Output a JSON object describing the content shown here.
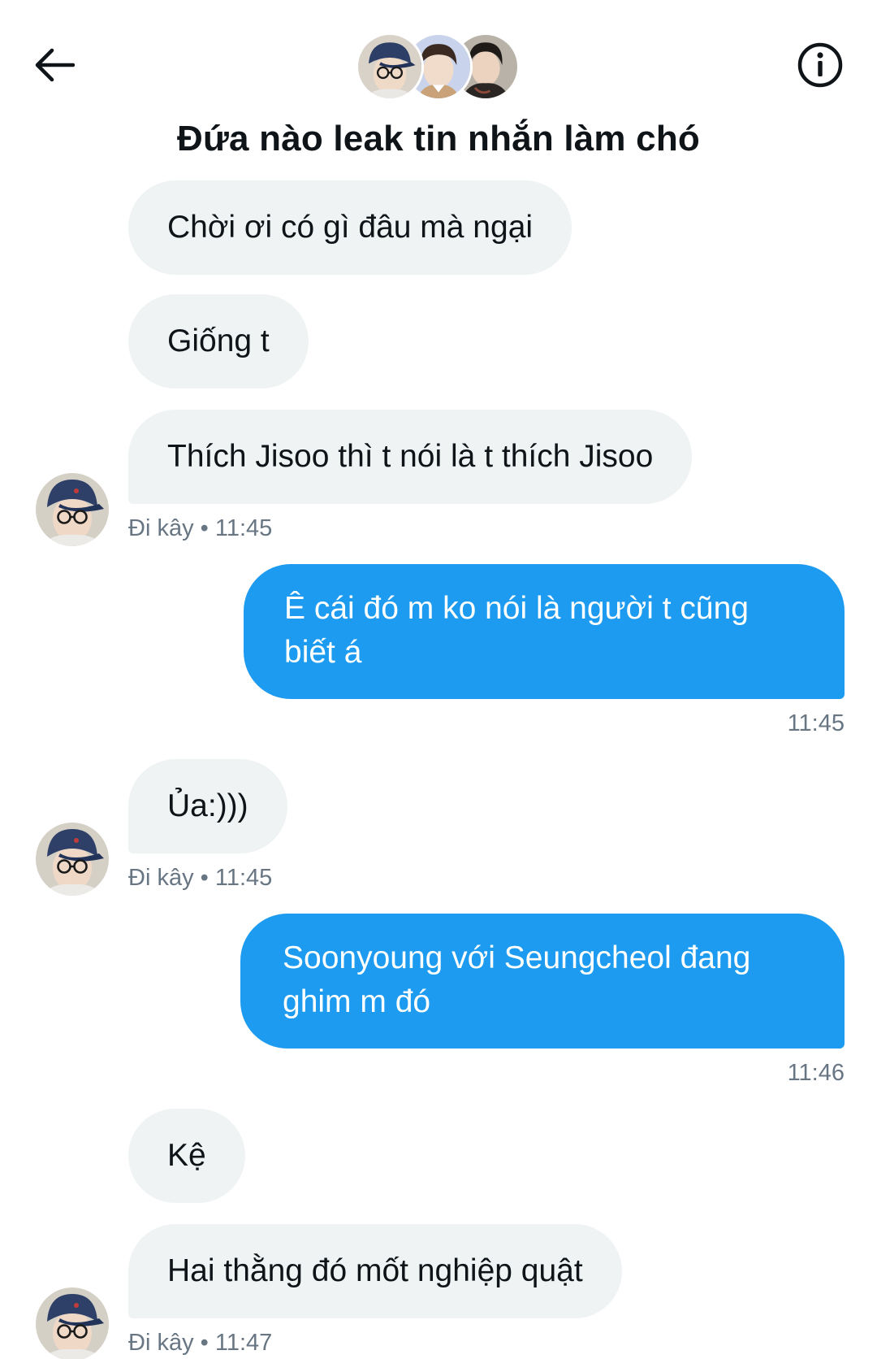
{
  "header": {
    "title": "Đứa nào leak tin nhắn làm chó",
    "back_icon": "arrow-left-icon",
    "info_icon": "info-icon"
  },
  "colors": {
    "outgoing_bubble": "#1d9bf0",
    "incoming_bubble": "#eff3f4",
    "meta_text": "#687684"
  },
  "messages": [
    {
      "direction": "in",
      "text": "Chời ơi có gì đâu mà ngại"
    },
    {
      "direction": "in",
      "text": "Giống t"
    },
    {
      "direction": "in",
      "text": "Thích Jisoo thì t nói là t thích Jisoo",
      "meta": "Đi kây • 11:45"
    },
    {
      "direction": "out",
      "text": "Ê cái đó m ko nói là người t cũng biết á",
      "meta": "11:45"
    },
    {
      "direction": "in",
      "text": "Ủa:)))",
      "meta": "Đi kây • 11:45"
    },
    {
      "direction": "out",
      "text": "Soonyoung với Seungcheol đang ghim m đó",
      "meta": "11:46"
    },
    {
      "direction": "in",
      "text": "Kệ"
    },
    {
      "direction": "in",
      "text": "Hai thằng đó mốt nghiệp quật",
      "meta": "Đi kây • 11:47"
    }
  ]
}
